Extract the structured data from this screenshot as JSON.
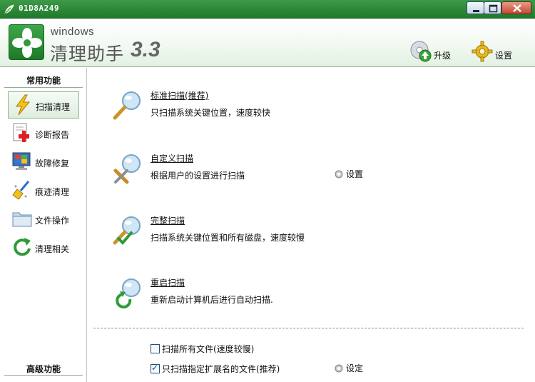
{
  "window": {
    "title": "01D8A249",
    "controls": [
      "minimize-icon",
      "maximize-icon",
      "close-icon"
    ]
  },
  "header": {
    "brand_small": "windows",
    "brand_main": "清理助手",
    "brand_version": "3.3",
    "upgrade_label": "升级",
    "settings_label": "设置"
  },
  "sidebar": {
    "common_title": "常用功能",
    "advanced_title": "高级功能",
    "items": [
      {
        "label": "扫描清理",
        "icon": "lightning-icon",
        "active": true
      },
      {
        "label": "诊断报告",
        "icon": "report-cross-icon",
        "active": false
      },
      {
        "label": "故障修复",
        "icon": "monitor-repair-icon",
        "active": false
      },
      {
        "label": "痕迹清理",
        "icon": "broom-icon",
        "active": false
      },
      {
        "label": "文件操作",
        "icon": "folder-icon",
        "active": false
      },
      {
        "label": "清理相关",
        "icon": "refresh-arrow-icon",
        "active": false
      }
    ]
  },
  "main": {
    "scans": [
      {
        "name": "标准扫描(推荐)",
        "desc": "只扫描系统关键位置，速度较快",
        "icon": "magnifier-icon"
      },
      {
        "name": "自定义扫描",
        "desc": "根据用户的设置进行扫描",
        "icon": "magnifier-tools-icon",
        "setting_label": "设置"
      },
      {
        "name": "完整扫描",
        "desc": "扫描系统关键位置和所有磁盘，速度较慢",
        "icon": "magnifier-check-icon"
      },
      {
        "name": "重启扫描",
        "desc": "重新启动计算机后进行自动扫描.",
        "icon": "magnifier-refresh-icon"
      }
    ],
    "options": [
      {
        "label": "扫描所有文件(速度较慢)",
        "checked": false
      },
      {
        "label": "只扫描指定扩展名的文件(推荐)",
        "checked": true
      }
    ],
    "extension_setting_label": "设定"
  },
  "colors": {
    "titlebar": "#2a8a36",
    "header_bg": "#e9f5e9",
    "accent_green": "#2e9a3a",
    "close_button": "#c44a33"
  }
}
